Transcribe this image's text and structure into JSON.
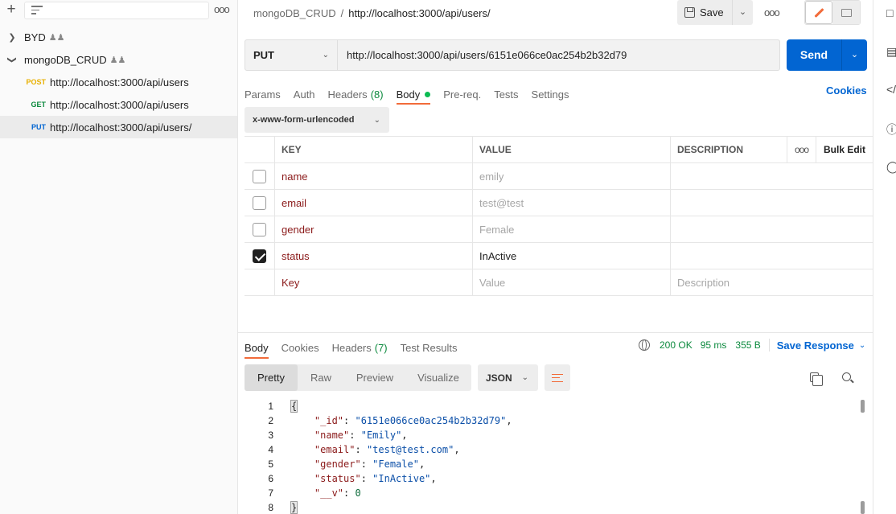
{
  "sidebar": {
    "collections": [
      {
        "name": "BYD",
        "expanded": false
      },
      {
        "name": "mongoDB_CRUD",
        "expanded": true
      }
    ],
    "requests": [
      {
        "method": "POST",
        "method_color": "#e8b000",
        "url": "http://localhost:3000/api/users"
      },
      {
        "method": "GET",
        "method_color": "#0c8a3e",
        "url": "http://localhost:3000/api/users"
      },
      {
        "method": "PUT",
        "method_color": "#0265d2",
        "url": "http://localhost:3000/api/users/"
      }
    ]
  },
  "header": {
    "collection": "mongoDB_CRUD",
    "separator": "/",
    "request_name": "http://localhost:3000/api/users/",
    "save_label": "Save"
  },
  "request": {
    "method": "PUT",
    "url": "http://localhost:3000/api/users/6151e066ce0ac254b2b32d79",
    "send_label": "Send",
    "tabs": [
      {
        "label": "Params"
      },
      {
        "label": "Auth"
      },
      {
        "label": "Headers",
        "count": "(8)"
      },
      {
        "label": "Body",
        "active": true
      },
      {
        "label": "Pre-req."
      },
      {
        "label": "Tests"
      },
      {
        "label": "Settings"
      }
    ],
    "cookies_label": "Cookies",
    "body_type": "x-www-form-urlencoded"
  },
  "params_table": {
    "headers": {
      "key": "KEY",
      "value": "VALUE",
      "description": "DESCRIPTION",
      "bulk_edit": "Bulk Edit"
    },
    "rows": [
      {
        "checked": false,
        "key": "name",
        "value": "emily",
        "description": ""
      },
      {
        "checked": false,
        "key": "email",
        "value": "test@test",
        "description": ""
      },
      {
        "checked": false,
        "key": "gender",
        "value": "Female",
        "description": ""
      },
      {
        "checked": true,
        "key": "status",
        "value": "InActive",
        "description": ""
      }
    ],
    "placeholder": {
      "key": "Key",
      "value": "Value",
      "description": "Description"
    }
  },
  "response": {
    "tabs": [
      {
        "label": "Body",
        "active": true
      },
      {
        "label": "Cookies"
      },
      {
        "label": "Headers",
        "count": "(7)"
      },
      {
        "label": "Test Results"
      }
    ],
    "status": "200 OK",
    "time": "95 ms",
    "size": "355 B",
    "save_response_label": "Save Response",
    "format_tabs": [
      "Pretty",
      "Raw",
      "Preview",
      "Visualize"
    ],
    "active_format": "Pretty",
    "language": "JSON",
    "body_lines": [
      {
        "n": "1",
        "text": "{"
      },
      {
        "n": "2",
        "text": "    \"_id\": \"6151e066ce0ac254b2b32d79\","
      },
      {
        "n": "3",
        "text": "    \"name\": \"Emily\","
      },
      {
        "n": "4",
        "text": "    \"email\": \"test@test.com\","
      },
      {
        "n": "5",
        "text": "    \"gender\": \"Female\","
      },
      {
        "n": "6",
        "text": "    \"status\": \"InActive\","
      },
      {
        "n": "7",
        "text": "    \"__v\": 0"
      },
      {
        "n": "8",
        "text": "}"
      }
    ]
  },
  "colors": {
    "accent": "#f26b3a",
    "primary": "#0265d2",
    "success": "#0c8a3e"
  }
}
